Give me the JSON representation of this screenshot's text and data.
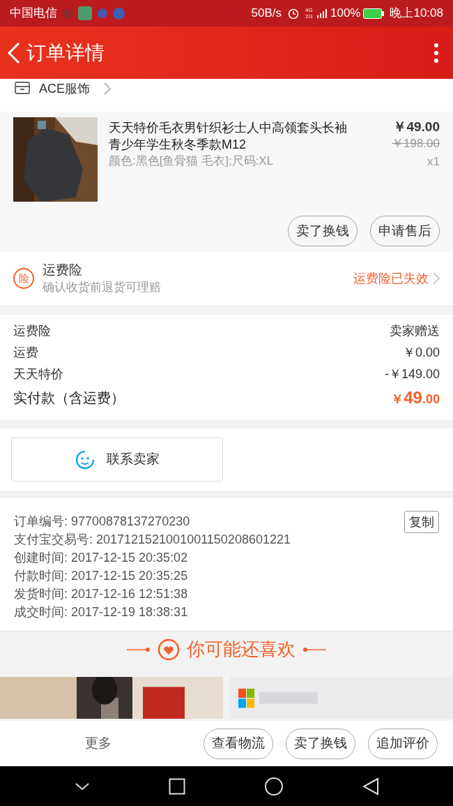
{
  "status_bar": {
    "carrier": "中国电信",
    "speed": "50B/s",
    "network": "4G 2G",
    "battery": "100%",
    "time": "晚上10:08"
  },
  "header": {
    "title": "订单详情"
  },
  "store": {
    "name": "ACE服饰"
  },
  "product": {
    "title": "天天特价毛衣男针织衫士人中高领套头长袖青少年学生秋冬季款M12",
    "sku": "颜色:黑色[鱼骨猫 毛衣];尺码:XL",
    "price": "￥49.00",
    "original_price": "￥198.00",
    "quantity": "x1",
    "actions": [
      "卖了换钱",
      "申请售后"
    ]
  },
  "insurance": {
    "badge": "险",
    "title": "运费险",
    "subtitle": "确认收货前退货可理赔",
    "status": "运费险已失效"
  },
  "fees": [
    {
      "label": "运费险",
      "value": "卖家赠送"
    },
    {
      "label": "运费",
      "value": "￥0.00"
    },
    {
      "label": "天天特价",
      "value": "-￥149.00"
    }
  ],
  "total": {
    "label": "实付款（含运费）",
    "currency": "￥",
    "integer": "49",
    "decimal": ".00"
  },
  "contact": {
    "label": "联系卖家"
  },
  "order_info": {
    "copy_button": "复制",
    "lines": [
      "订单编号: 97700878137270230",
      "支付宝交易号: 2017121521001001150208601221",
      "创建时间: 2017-12-15 20:35:02",
      "付款时间: 2017-12-15 20:35:25",
      "发货时间: 2017-12-16 12:51:38",
      "成交时间: 2017-12-19 18:38:31"
    ]
  },
  "recommend": {
    "title": "你可能还喜欢"
  },
  "bottom_bar": {
    "more": "更多",
    "buttons": [
      "查看物流",
      "卖了换钱",
      "追加评价"
    ]
  }
}
